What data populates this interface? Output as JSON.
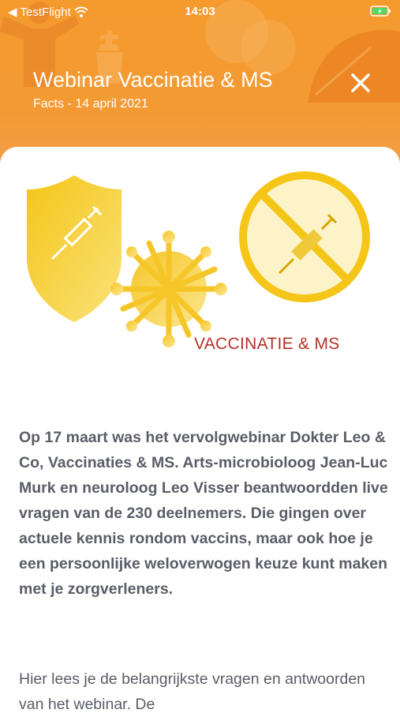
{
  "status_bar": {
    "back_app": "TestFlight",
    "time": "14:03"
  },
  "header": {
    "title": "Webinar Vaccinatie & MS",
    "subtitle": "Facts - 14 april 2021",
    "close_icon": "close-icon",
    "background_color": "#f59a2c"
  },
  "hero": {
    "label": "VACCINATIE & MS",
    "label_color": "#b3322b",
    "icons": [
      "shield-syringe-icon",
      "virus-icon",
      "no-syringe-icon"
    ]
  },
  "article": {
    "paragraph_1": "Op 17 maart was het vervolgwebinar Dokter Leo & Co, Vaccinaties & MS. Arts-microbioloog Jean-Luc Murk en neuroloog Leo Visser beantwoordden live vragen van de 230 deelnemers. Die gingen over actuele kennis rondom vaccins, maar ook hoe je een persoonlijke weloverwogen keuze kunt maken met je zorgverleners.",
    "paragraph_2": "Hier lees je de belangrijkste vragen en antwoorden van het webinar. De"
  }
}
